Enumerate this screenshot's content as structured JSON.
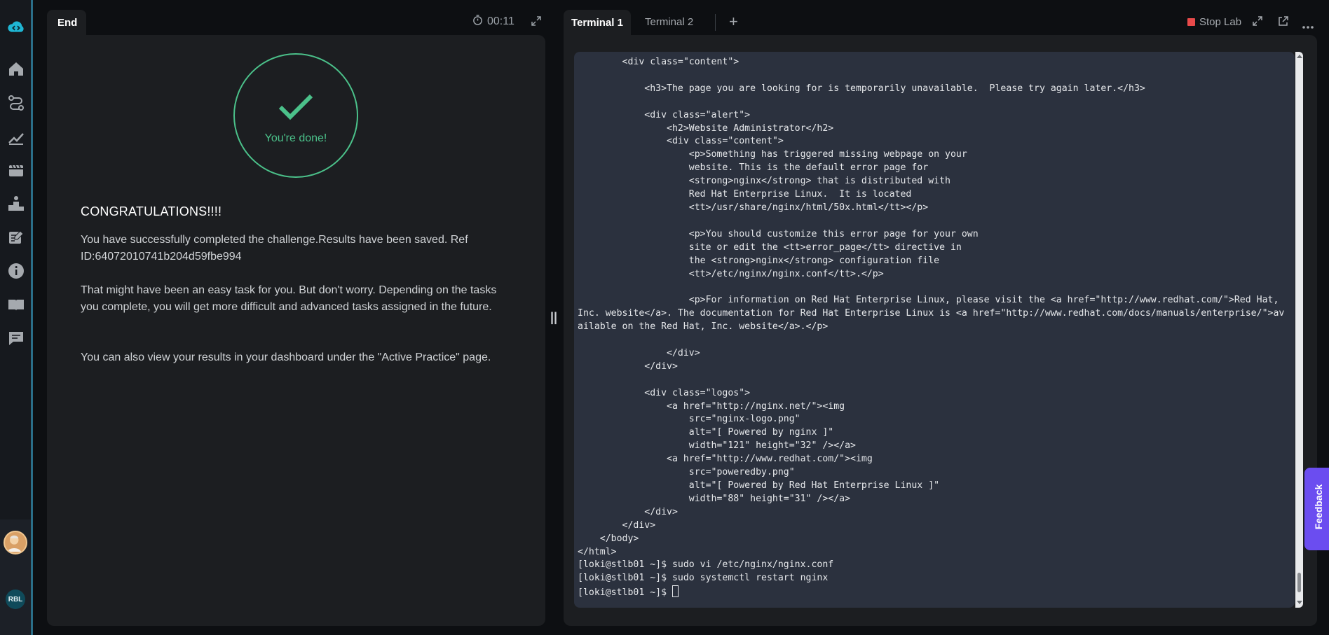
{
  "sidebar": {
    "icons": [
      "app-logo-icon",
      "home-icon",
      "route-icon",
      "progress-chart-icon",
      "film-icon",
      "leaderboard-icon",
      "edit-notes-icon",
      "info-icon",
      "book-icon",
      "chat-icon"
    ],
    "user_initials": "RBL"
  },
  "left_panel": {
    "tab_label": "End",
    "timer": "00:11",
    "done_text": "You're done!",
    "heading": "CONGRATULATIONS!!!!",
    "paragraphs": [
      "You have successfully completed the challenge.Results have been saved. Ref ID:64072010741b204d59fbe994",
      "That might have been an easy task for you. But don't worry. Depending on the tasks you complete, you will get more difficult and advanced tasks assigned in the future.",
      "You can also view your results in your dashboard under the \"Active Practice\" page."
    ],
    "accent_color": "#4bc18a"
  },
  "right_panel": {
    "tabs": [
      "Terminal 1",
      "Terminal 2"
    ],
    "add_tab": "+",
    "stop_label": "Stop Lab",
    "terminal_lines": [
      "        <div class=\"content\">",
      "",
      "            <h3>The page you are looking for is temporarily unavailable.  Please try again later.</h3>",
      "",
      "            <div class=\"alert\">",
      "                <h2>Website Administrator</h2>",
      "                <div class=\"content\">",
      "                    <p>Something has triggered missing webpage on your",
      "                    website. This is the default error page for",
      "                    <strong>nginx</strong> that is distributed with",
      "                    Red Hat Enterprise Linux.  It is located",
      "                    <tt>/usr/share/nginx/html/50x.html</tt></p>",
      "",
      "                    <p>You should customize this error page for your own",
      "                    site or edit the <tt>error_page</tt> directive in",
      "                    the <strong>nginx</strong> configuration file",
      "                    <tt>/etc/nginx/nginx.conf</tt>.</p>",
      "",
      "                    <p>For information on Red Hat Enterprise Linux, please visit the <a href=\"http://www.redhat.com/\">Red Hat,",
      "Inc. website</a>. The documentation for Red Hat Enterprise Linux is <a href=\"http://www.redhat.com/docs/manuals/enterprise/\">av",
      "ailable on the Red Hat, Inc. website</a>.</p>",
      "",
      "                </div>",
      "            </div>",
      "",
      "            <div class=\"logos\">",
      "                <a href=\"http://nginx.net/\"><img",
      "                    src=\"nginx-logo.png\"",
      "                    alt=\"[ Powered by nginx ]\"",
      "                    width=\"121\" height=\"32\" /></a>",
      "                <a href=\"http://www.redhat.com/\"><img",
      "                    src=\"poweredby.png\"",
      "                    alt=\"[ Powered by Red Hat Enterprise Linux ]\"",
      "                    width=\"88\" height=\"31\" /></a>",
      "            </div>",
      "        </div>",
      "    </body>",
      "</html>",
      "[loki@stlb01 ~]$ sudo vi /etc/nginx/nginx.conf",
      "[loki@stlb01 ~]$ sudo systemctl restart nginx"
    ],
    "prompt": "[loki@stlb01 ~]$ "
  },
  "feedback_label": "Feedback"
}
